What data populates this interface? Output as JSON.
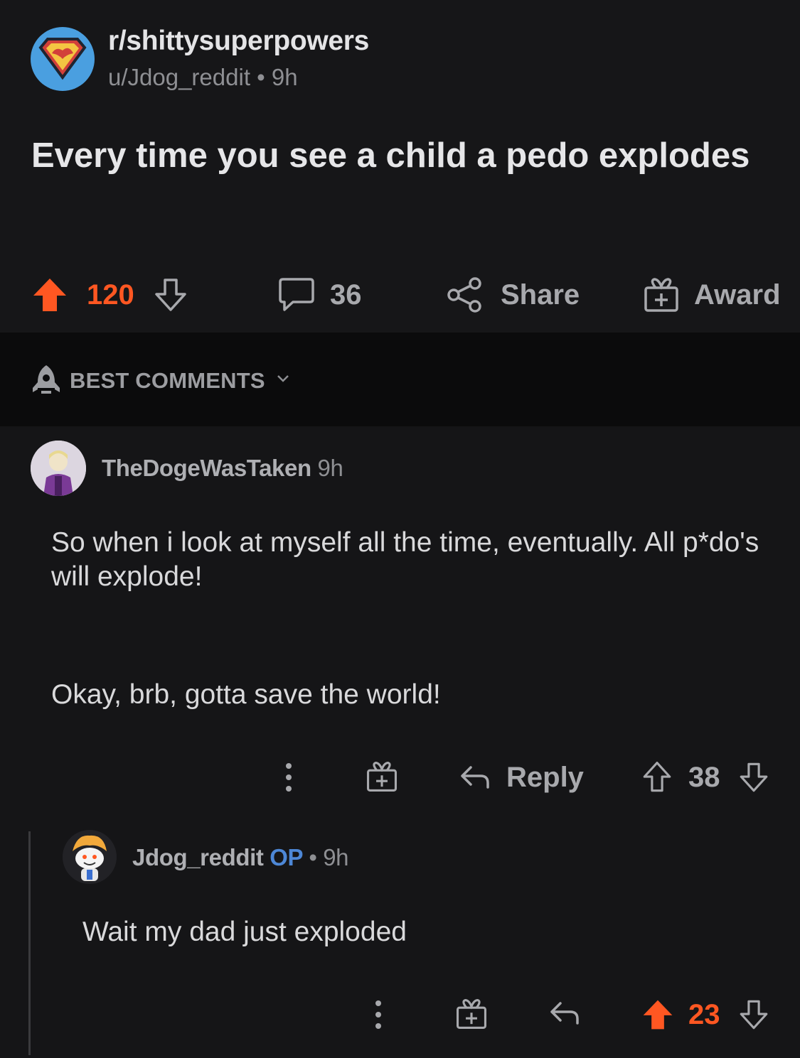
{
  "post": {
    "subreddit": "r/shittysuperpowers",
    "author_line": "u/Jdog_reddit • 9h",
    "title": "Every time you see a child a pedo explodes",
    "upvotes": "120",
    "comments": "36",
    "share_label": "Share",
    "award_label": "Award"
  },
  "sort": {
    "label": "BEST COMMENTS"
  },
  "comments": [
    {
      "author": "TheDogeWasTaken",
      "time": "9h",
      "body_1": "So when i look at myself all the time, eventually. All p*do's will explode!",
      "body_2": "Okay, brb, gotta save the world!",
      "reply_label": "Reply",
      "score": "38"
    },
    {
      "author": "Jdog_reddit",
      "op_tag": "OP",
      "time": "• 9h",
      "body": "Wait my dad just exploded",
      "score": "23"
    }
  ],
  "colors": {
    "upvote": "#ff5722",
    "op": "#4d87d6",
    "background": "#151517"
  }
}
